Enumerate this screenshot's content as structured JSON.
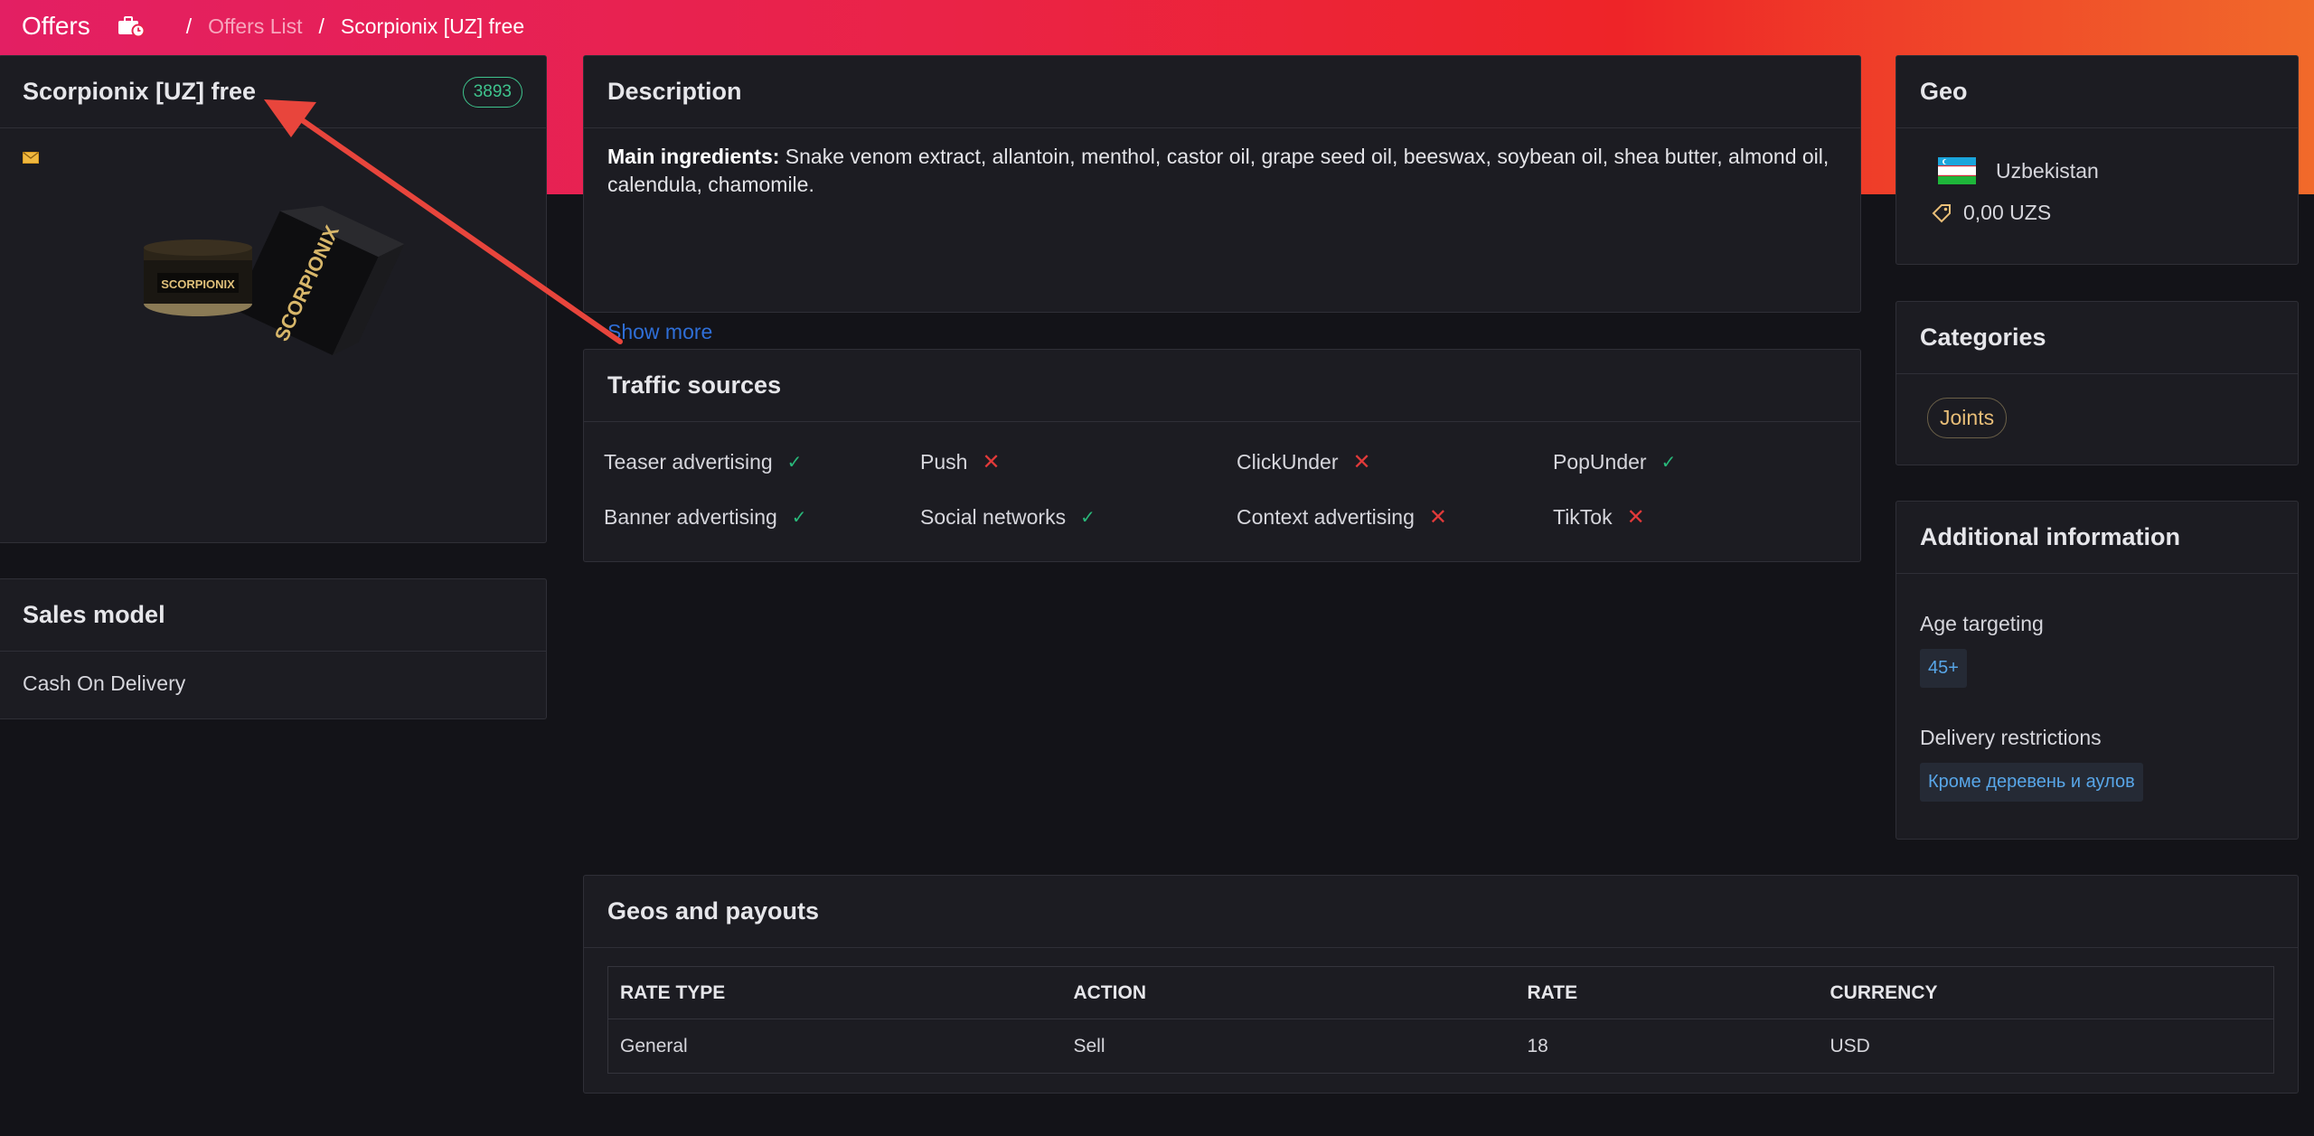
{
  "topbar": {
    "title": "Offers",
    "home_icon": "briefcase-clock-icon",
    "breadcrumb": {
      "separator": "/",
      "link": "Offers List",
      "current": "Scorpionix [UZ] free"
    }
  },
  "offer": {
    "name": "Scorpionix [UZ] free",
    "id": "3893",
    "mail_icon": "envelope-icon",
    "product_label": "SCORPIONIX"
  },
  "sales_model": {
    "title": "Sales model",
    "value": "Cash On Delivery"
  },
  "description": {
    "title": "Description",
    "bold_label": "Main ingredients:",
    "text": " Snake venom extract, allantoin, menthol, castor oil, grape seed oil, beeswax, soybean oil, shea butter, almond oil, calendula, chamomile.",
    "show_more": "Show more"
  },
  "traffic": {
    "title": "Traffic sources",
    "check_symbol": "✓",
    "cross_symbol": "✕",
    "items": [
      {
        "label": "Teaser advertising",
        "allowed": true
      },
      {
        "label": "Push",
        "allowed": false
      },
      {
        "label": "ClickUnder",
        "allowed": false
      },
      {
        "label": "PopUnder",
        "allowed": true
      },
      {
        "label": "Banner advertising",
        "allowed": true
      },
      {
        "label": "Social networks",
        "allowed": true
      },
      {
        "label": "Context advertising",
        "allowed": false
      },
      {
        "label": "TikTok",
        "allowed": false
      }
    ]
  },
  "geo": {
    "title": "Geo",
    "country": "Uzbekistan",
    "flag_icon": "uzbekistan-flag-icon",
    "price_icon": "price-tag-icon",
    "price": "0,00 UZS"
  },
  "categories": {
    "title": "Categories",
    "items": [
      "Joints"
    ]
  },
  "additional": {
    "title": "Additional information",
    "age_label": "Age targeting",
    "age_value": "45+",
    "delivery_label": "Delivery restrictions",
    "delivery_value": "Кроме деревень и аулов"
  },
  "payouts": {
    "title": "Geos and payouts",
    "columns": [
      "RATE TYPE",
      "ACTION",
      "RATE",
      "CURRENCY"
    ],
    "rows": [
      [
        "General",
        "Sell",
        "18",
        "USD"
      ]
    ]
  },
  "colors": {
    "header_gradient_start": "#e31f63",
    "header_gradient_end": "#f16a2a",
    "background": "#131318",
    "card": "#1c1c22",
    "success": "#29b87a",
    "danger": "#e23a3a",
    "link": "#2f6fd8",
    "annotation_arrow": "#e8453c"
  }
}
